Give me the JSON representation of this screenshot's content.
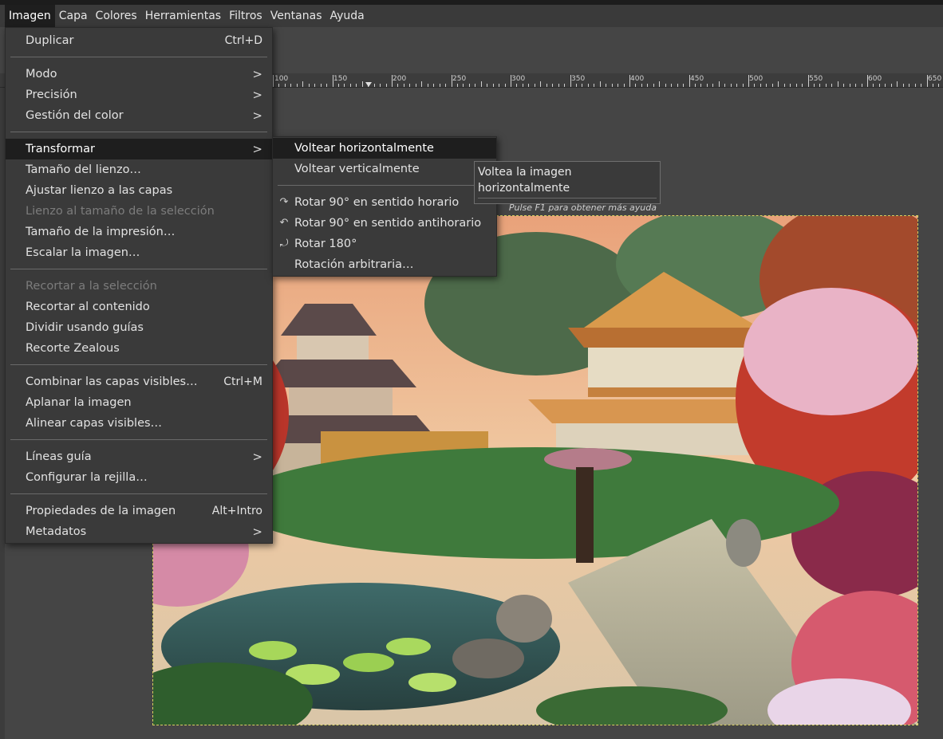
{
  "menubar": {
    "items": [
      "Imagen",
      "Capa",
      "Colores",
      "Herramientas",
      "Filtros",
      "Ventanas",
      "Ayuda"
    ],
    "active": "Imagen"
  },
  "ruler": {
    "labels": [
      "100",
      "150",
      "200",
      "250",
      "300",
      "350",
      "400",
      "450",
      "500",
      "550",
      "600",
      "650"
    ]
  },
  "image_menu": {
    "duplicate": {
      "label": "Duplicar",
      "accel": "Ctrl+D"
    },
    "mode": {
      "label": "Modo"
    },
    "precision": {
      "label": "Precisión"
    },
    "color_management": {
      "label": "Gestión del color"
    },
    "transform": {
      "label": "Transformar"
    },
    "canvas_size": {
      "label": "Tamaño del lienzo…"
    },
    "fit_canvas_layers": {
      "label": "Ajustar lienzo a las capas"
    },
    "canvas_to_selection": {
      "label": "Lienzo al tamaño de la selección"
    },
    "print_size": {
      "label": "Tamaño de la impresión…"
    },
    "scale_image": {
      "label": "Escalar la imagen…"
    },
    "crop_to_selection": {
      "label": "Recortar a la selección"
    },
    "crop_to_content": {
      "label": "Recortar al contenido"
    },
    "slice_guides": {
      "label": "Dividir usando guías"
    },
    "zealous_crop": {
      "label": "Recorte Zealous"
    },
    "merge_visible": {
      "label": "Combinar las capas visibles…",
      "accel": "Ctrl+M"
    },
    "flatten": {
      "label": "Aplanar la imagen"
    },
    "align_layers": {
      "label": "Alinear capas visibles…"
    },
    "guides": {
      "label": "Líneas guía"
    },
    "configure_grid": {
      "label": "Configurar la rejilla…"
    },
    "properties": {
      "label": "Propiedades de la imagen",
      "accel": "Alt+Intro"
    },
    "metadata": {
      "label": "Metadatos"
    },
    "submenu_arrow": ">"
  },
  "transform_submenu": {
    "flip_h": {
      "label": "Voltear horizontalmente"
    },
    "flip_v": {
      "label": "Voltear verticalmente"
    },
    "rotate_cw": {
      "label": "Rotar 90° en sentido horario",
      "icon": "rotate-cw-icon"
    },
    "rotate_ccw": {
      "label": "Rotar 90° en sentido antihorario",
      "icon": "rotate-ccw-icon"
    },
    "rotate_180": {
      "label": "Rotar 180°",
      "icon": "rotate-180-icon"
    },
    "arbitrary": {
      "label": "Rotación arbitraria…"
    }
  },
  "tooltip": {
    "text": "Voltea la imagen horizontalmente",
    "help": "Pulse F1 para obtener más ayuda"
  },
  "colors": {
    "menu_bg": "#3a3a3a",
    "highlight": "#1e1e1e",
    "canvas_bg": "#454545",
    "selection_border": "#d8d060"
  }
}
